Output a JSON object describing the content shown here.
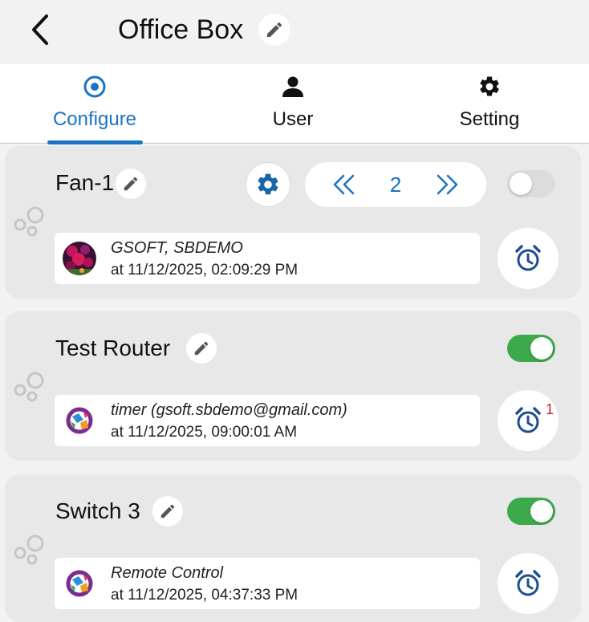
{
  "header": {
    "title": "Office Box"
  },
  "tabs": [
    {
      "label": "Configure",
      "icon": "target-icon",
      "active": true
    },
    {
      "label": "User",
      "icon": "user-icon"
    },
    {
      "label": "Setting",
      "icon": "gear-icon"
    }
  ],
  "colors": {
    "accent": "#1a73c4",
    "toggle_on": "#3caa4c",
    "badge": "#d32222",
    "card_bg": "#e8e8e8"
  },
  "devices": [
    {
      "name": "Fan-1",
      "toggle_on": false,
      "speed": "2",
      "activity": {
        "by": "GSOFT, SBDEMO",
        "at": "at 11/12/2025, 02:09:29 PM",
        "avatar": "flower-photo"
      },
      "alarm_badge": ""
    },
    {
      "name": "Test Router",
      "toggle_on": true,
      "activity": {
        "by": "timer (gsoft.sbdemo@gmail.com)",
        "at": "at 11/12/2025, 09:00:01 AM",
        "avatar": "app-logo"
      },
      "alarm_badge": "1"
    },
    {
      "name": "Switch 3",
      "toggle_on": true,
      "activity": {
        "by": "Remote Control",
        "at": "at 11/12/2025, 04:37:33 PM",
        "avatar": "app-logo"
      },
      "alarm_badge": ""
    }
  ]
}
